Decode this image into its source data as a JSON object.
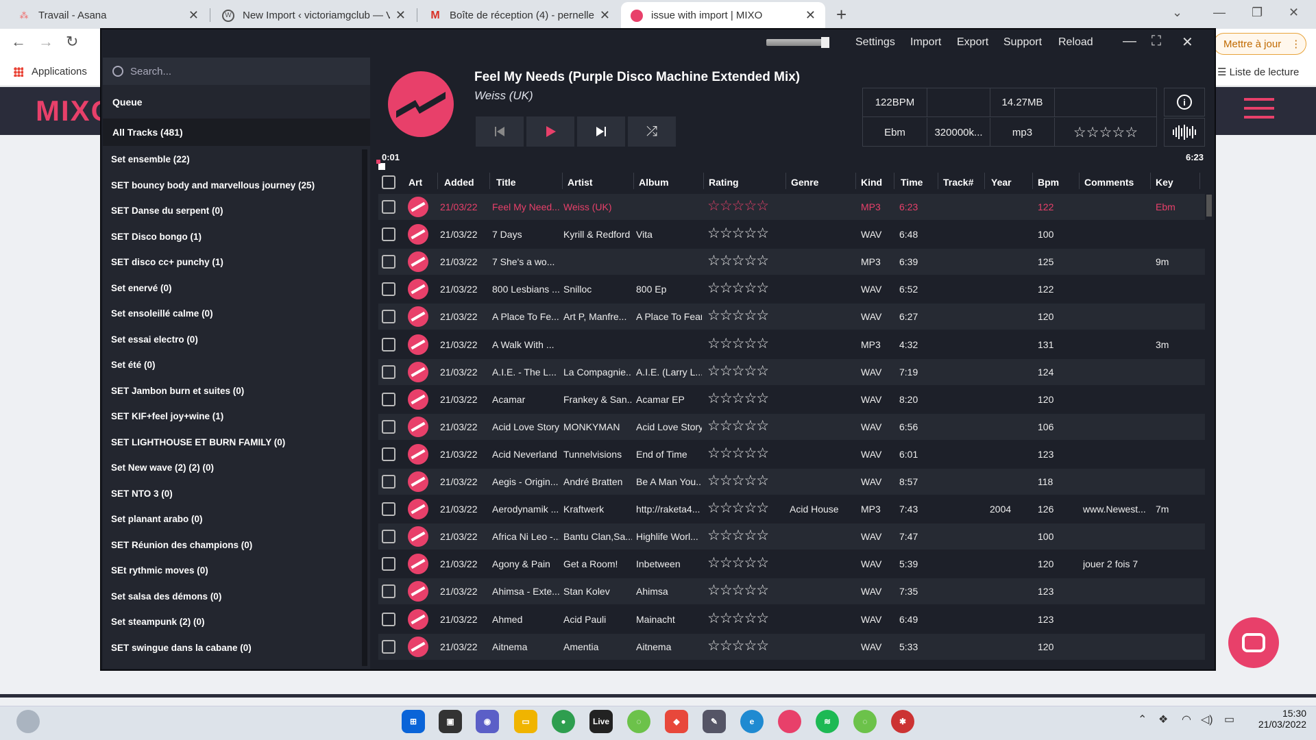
{
  "browser": {
    "tabs": [
      {
        "title": "Travail - Asana",
        "icon": "asana-icon"
      },
      {
        "title": "New Import ‹ victoriamgclub — V",
        "icon": "wordpress-icon"
      },
      {
        "title": "Boîte de réception (4) - pernelle.l",
        "icon": "gmail-icon"
      },
      {
        "title": "issue with import | MIXO",
        "icon": "mixo-icon"
      }
    ],
    "update_button": "Mettre à jour",
    "bookmarks_apps": "Applications",
    "reading_list": "Liste de lecture"
  },
  "site": {
    "logo": "MIXO"
  },
  "app": {
    "menu": {
      "settings": "Settings",
      "import": "Import",
      "export": "Export",
      "support": "Support",
      "reload": "Reload"
    },
    "search_placeholder": "Search...",
    "queue": "Queue",
    "all_tracks": "All Tracks (481)",
    "sets": [
      "Set ensemble (22)",
      "SET bouncy body and marvellous journey (25)",
      "SET Danse du serpent (0)",
      "SET Disco bongo (1)",
      "SET disco cc+ punchy (1)",
      "Set enervé (0)",
      "Set ensoleillé calme (0)",
      "Set essai electro (0)",
      "Set été (0)",
      "SET Jambon burn et suites (0)",
      "SET KIF+feel joy+wine (1)",
      "SET LIGHTHOUSE ET BURN FAMILY (0)",
      "Set New wave (2) (2) (0)",
      "SET NTO 3 (0)",
      "Set planant arabo (0)",
      "SET Réunion des champions (0)",
      "SEt rythmic moves (0)",
      "Set salsa des démons (0)",
      "Set steampunk (2) (0)",
      "SET swingue dans la cabane (0)"
    ],
    "now_playing": {
      "title": "Feel My Needs (Purple Disco Machine Extended Mix)",
      "artist": "Weiss (UK)",
      "bpm": "122BPM",
      "size": "14.27MB",
      "key": "Ebm",
      "bitrate": "320000k...",
      "format": "mp3",
      "rating_stars": "☆☆☆☆☆",
      "position": "0:01",
      "duration": "6:23",
      "progress": 0.003
    },
    "columns": [
      "Art",
      "Added",
      "Title",
      "Artist",
      "Album",
      "Rating",
      "Genre",
      "Kind",
      "Time",
      "Track#",
      "Year",
      "Bpm",
      "Comments",
      "Key"
    ],
    "tracks": [
      {
        "added": "21/03/22",
        "title": "Feel My Need...",
        "artist": "Weiss (UK)",
        "album": "",
        "genre": "",
        "kind": "MP3",
        "time": "6:23",
        "year": "",
        "bpm": "122",
        "comments": "",
        "key": "Ebm",
        "playing": true
      },
      {
        "added": "21/03/22",
        "title": "7 Days",
        "artist": "Kyrill & Redford",
        "album": "Vita",
        "genre": "",
        "kind": "WAV",
        "time": "6:48",
        "year": "",
        "bpm": "100",
        "comments": "",
        "key": ""
      },
      {
        "added": "21/03/22",
        "title": "7 She's a wo...",
        "artist": "",
        "album": "",
        "genre": "",
        "kind": "MP3",
        "time": "6:39",
        "year": "",
        "bpm": "125",
        "comments": "",
        "key": "9m"
      },
      {
        "added": "21/03/22",
        "title": "800 Lesbians ...",
        "artist": "Snilloc",
        "album": "800 Ep",
        "genre": "",
        "kind": "WAV",
        "time": "6:52",
        "year": "",
        "bpm": "122",
        "comments": "",
        "key": ""
      },
      {
        "added": "21/03/22",
        "title": "A Place To Fe...",
        "artist": "Art P, Manfre...",
        "album": "A Place To Fear",
        "genre": "",
        "kind": "WAV",
        "time": "6:27",
        "year": "",
        "bpm": "120",
        "comments": "",
        "key": ""
      },
      {
        "added": "21/03/22",
        "title": "A Walk With ...",
        "artist": "",
        "album": "",
        "genre": "",
        "kind": "MP3",
        "time": "4:32",
        "year": "",
        "bpm": "131",
        "comments": "",
        "key": "3m"
      },
      {
        "added": "21/03/22",
        "title": "A.I.E. - The L...",
        "artist": "La Compagnie...",
        "album": "A.I.E. (Larry L...",
        "genre": "",
        "kind": "WAV",
        "time": "7:19",
        "year": "",
        "bpm": "124",
        "comments": "",
        "key": ""
      },
      {
        "added": "21/03/22",
        "title": "Acamar",
        "artist": "Frankey & San...",
        "album": "Acamar EP",
        "genre": "",
        "kind": "WAV",
        "time": "8:20",
        "year": "",
        "bpm": "120",
        "comments": "",
        "key": ""
      },
      {
        "added": "21/03/22",
        "title": "Acid Love Story",
        "artist": "MONKYMAN",
        "album": "Acid Love Story",
        "genre": "",
        "kind": "WAV",
        "time": "6:56",
        "year": "",
        "bpm": "106",
        "comments": "",
        "key": ""
      },
      {
        "added": "21/03/22",
        "title": "Acid Neverland",
        "artist": "Tunnelvisions",
        "album": "End of Time",
        "genre": "",
        "kind": "WAV",
        "time": "6:01",
        "year": "",
        "bpm": "123",
        "comments": "",
        "key": ""
      },
      {
        "added": "21/03/22",
        "title": "Aegis - Origin...",
        "artist": "André Bratten",
        "album": "Be A Man You...",
        "genre": "",
        "kind": "WAV",
        "time": "8:57",
        "year": "",
        "bpm": "118",
        "comments": "",
        "key": ""
      },
      {
        "added": "21/03/22",
        "title": "Aerodynamik ...",
        "artist": "Kraftwerk",
        "album": "http://raketa4...",
        "genre": "Acid House",
        "kind": "MP3",
        "time": "7:43",
        "year": "2004",
        "bpm": "126",
        "comments": "www.Newest...",
        "key": "7m"
      },
      {
        "added": "21/03/22",
        "title": "Africa Ni Leo -...",
        "artist": "Bantu Clan,Sa...",
        "album": "Highlife Worl...",
        "genre": "",
        "kind": "WAV",
        "time": "7:47",
        "year": "",
        "bpm": "100",
        "comments": "",
        "key": ""
      },
      {
        "added": "21/03/22",
        "title": "Agony & Pain",
        "artist": "Get a Room!",
        "album": "Inbetween",
        "genre": "",
        "kind": "WAV",
        "time": "5:39",
        "year": "",
        "bpm": "120",
        "comments": "jouer 2 fois 7",
        "key": ""
      },
      {
        "added": "21/03/22",
        "title": "Ahimsa - Exte...",
        "artist": "Stan Kolev",
        "album": "Ahimsa",
        "genre": "",
        "kind": "WAV",
        "time": "7:35",
        "year": "",
        "bpm": "123",
        "comments": "",
        "key": ""
      },
      {
        "added": "21/03/22",
        "title": "Ahmed",
        "artist": "Acid Pauli",
        "album": "Mainacht",
        "genre": "",
        "kind": "WAV",
        "time": "6:49",
        "year": "",
        "bpm": "123",
        "comments": "",
        "key": ""
      },
      {
        "added": "21/03/22",
        "title": "Aitnema",
        "artist": "Amentia",
        "album": "Aitnema",
        "genre": "",
        "kind": "WAV",
        "time": "5:33",
        "year": "",
        "bpm": "120",
        "comments": "",
        "key": ""
      }
    ],
    "row_stars": "☆☆☆☆☆"
  },
  "taskbar": {
    "clock_time": "15:30",
    "clock_date": "21/03/2022",
    "live_label": "Live"
  },
  "colors": {
    "accent": "#e8406a",
    "app_bg": "#1d2029"
  }
}
